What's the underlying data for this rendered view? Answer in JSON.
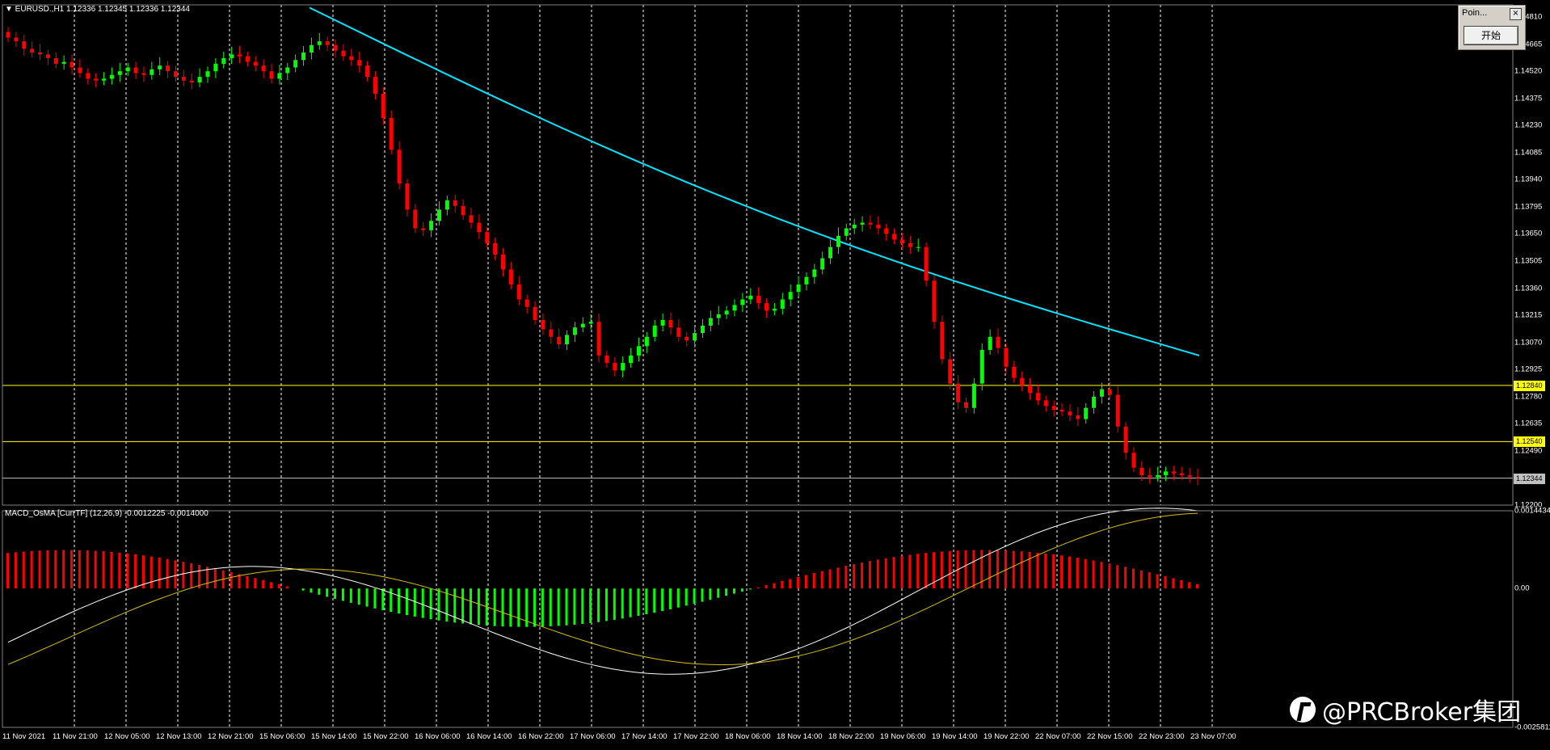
{
  "window": {
    "symbol_line": "▼ EURUSD.,H1  1.12336 1.12345 1.12336 1.12344",
    "indicator_line": "MACD_OsMA [CurrTF] (12,26,9) -0.0012225 -0.0014000"
  },
  "price_axis": {
    "ticks": [
      "1.14810",
      "1.14665",
      "1.14520",
      "1.14375",
      "1.14230",
      "1.14085",
      "1.13940",
      "1.13795",
      "1.13650",
      "1.13505",
      "1.13360",
      "1.13215",
      "1.13070",
      "1.12925",
      "1.12780",
      "1.12635",
      "1.12490",
      "1.12200"
    ],
    "tags": [
      {
        "label": "1.12840",
        "bg": "#ffff00",
        "fg": "#000000"
      },
      {
        "label": "1.12540",
        "bg": "#ffff00",
        "fg": "#000000"
      },
      {
        "label": "1.12344",
        "bg": "#c0c0c0",
        "fg": "#000000"
      }
    ]
  },
  "macd_axis": {
    "ticks": [
      "0.0014434",
      "0.00",
      "-0.0025811"
    ]
  },
  "time_axis": {
    "labels": [
      "11 Nov 2021",
      "11 Nov 21:00",
      "12 Nov 05:00",
      "12 Nov 13:00",
      "12 Nov 21:00",
      "15 Nov 06:00",
      "15 Nov 14:00",
      "15 Nov 22:00",
      "16 Nov 06:00",
      "16 Nov 14:00",
      "16 Nov 22:00",
      "17 Nov 06:00",
      "17 Nov 14:00",
      "17 Nov 22:00",
      "18 Nov 06:00",
      "18 Nov 14:00",
      "18 Nov 22:00",
      "19 Nov 06:00",
      "19 Nov 14:00",
      "19 Nov 22:00",
      "22 Nov 07:00",
      "22 Nov 15:00",
      "22 Nov 23:00",
      "23 Nov 07:00"
    ]
  },
  "horizontal_lines": [
    1.1284,
    1.1254
  ],
  "current_price": 1.12344,
  "colors": {
    "bull": "#00ff00",
    "bear": "#ff0000",
    "ma": "#00e5ff",
    "macd_line": "#ffffff",
    "signal_line": "#d4c000",
    "level_line": "#ffff00",
    "grid": "#ffffff"
  },
  "mini_window": {
    "title": "Poin...",
    "close_glyph": "×",
    "button": "开始"
  },
  "watermark": {
    "text": "@PRCBroker集团",
    "icon": "prcbroker-logo-icon"
  },
  "chart_data": {
    "type": "candlestick",
    "symbol": "EURUSD.",
    "timeframe": "H1",
    "ohlc_summary": {
      "open": 1.12336,
      "high": 1.12345,
      "low": 1.12336,
      "close": 1.12344
    },
    "closes": [
      1.147,
      1.1468,
      1.1464,
      1.1462,
      1.1461,
      1.1459,
      1.1456,
      1.1457,
      1.1454,
      1.1451,
      1.1448,
      1.1447,
      1.1448,
      1.145,
      1.1452,
      1.1454,
      1.1451,
      1.145,
      1.1453,
      1.1455,
      1.1452,
      1.1449,
      1.1447,
      1.1446,
      1.1449,
      1.1452,
      1.1456,
      1.1459,
      1.1461,
      1.146,
      1.1457,
      1.1455,
      1.1452,
      1.1448,
      1.1451,
      1.1454,
      1.1458,
      1.1462,
      1.1466,
      1.1468,
      1.1466,
      1.1463,
      1.146,
      1.1458,
      1.1455,
      1.1449,
      1.144,
      1.1427,
      1.141,
      1.1392,
      1.1378,
      1.1368,
      1.1367,
      1.1372,
      1.1378,
      1.1383,
      1.138,
      1.1375,
      1.1371,
      1.1366,
      1.136,
      1.1354,
      1.1346,
      1.1338,
      1.133,
      1.1326,
      1.1319,
      1.1314,
      1.131,
      1.1306,
      1.1311,
      1.1315,
      1.1317,
      1.1318,
      1.13,
      1.1296,
      1.1292,
      1.1296,
      1.13,
      1.1305,
      1.131,
      1.1316,
      1.1319,
      1.1315,
      1.131,
      1.1308,
      1.1312,
      1.1316,
      1.132,
      1.1322,
      1.1324,
      1.1327,
      1.133,
      1.1332,
      1.1328,
      1.1324,
      1.1325,
      1.133,
      1.1334,
      1.1338,
      1.1342,
      1.1346,
      1.1352,
      1.1358,
      1.1364,
      1.1368,
      1.137,
      1.1371,
      1.137,
      1.1368,
      1.1365,
      1.1362,
      1.136,
      1.1358,
      1.1358,
      1.134,
      1.1318,
      1.1298,
      1.1285,
      1.1275,
      1.1272,
      1.1285,
      1.1303,
      1.131,
      1.1304,
      1.1294,
      1.1288,
      1.1284,
      1.128,
      1.1276,
      1.1273,
      1.1271,
      1.127,
      1.1268,
      1.1266,
      1.1272,
      1.1278,
      1.1282,
      1.1279,
      1.1262,
      1.1248,
      1.124,
      1.1236,
      1.1235,
      1.1236,
      1.1238,
      1.1237,
      1.1236,
      1.1235,
      1.12344
    ],
    "moving_average": {
      "start": 1.1486,
      "end": 1.13
    },
    "macd_histogram_range": [
      -0.0025811,
      0.0014434
    ],
    "ylim": [
      1.122,
      1.1486
    ]
  }
}
